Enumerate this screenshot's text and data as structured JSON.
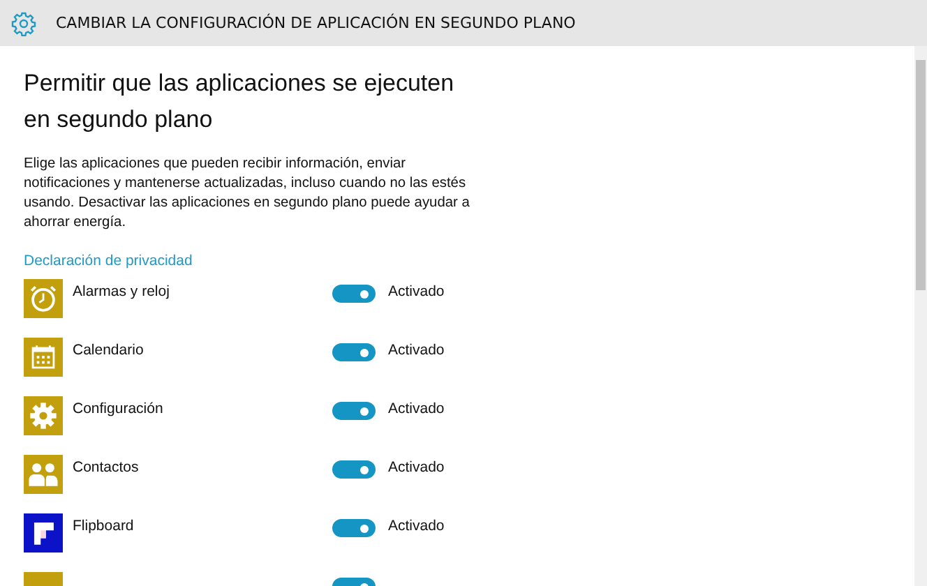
{
  "header": {
    "title": "CAMBIAR LA CONFIGURACIÓN DE APLICACIÓN EN SEGUNDO PLANO"
  },
  "heading": "Permitir que las aplicaciones se ejecuten en segundo plano",
  "description": "Elige las aplicaciones que pueden recibir información, enviar notificaciones y mantenerse actualizadas, incluso cuando no las estés usando. Desactivar las aplicaciones en segundo plano puede ayudar a ahorrar energía.",
  "privacy_link": "Declaración de privacidad",
  "apps": [
    {
      "name": "Alarmas y reloj",
      "kind": "alarm",
      "color": "#c29f0c",
      "on": true,
      "status": "Activado"
    },
    {
      "name": "Calendario",
      "kind": "calendar",
      "color": "#c29f0c",
      "on": true,
      "status": "Activado"
    },
    {
      "name": "Configuración",
      "kind": "gear",
      "color": "#c29f0c",
      "on": true,
      "status": "Activado"
    },
    {
      "name": "Contactos",
      "kind": "people",
      "color": "#c29f0c",
      "on": true,
      "status": "Activado"
    },
    {
      "name": "Flipboard",
      "kind": "flipboard",
      "color": "#0b12c8",
      "on": true,
      "status": "Activado"
    },
    {
      "kind": "blank",
      "color": "#c29f0c",
      "on": true
    }
  ]
}
